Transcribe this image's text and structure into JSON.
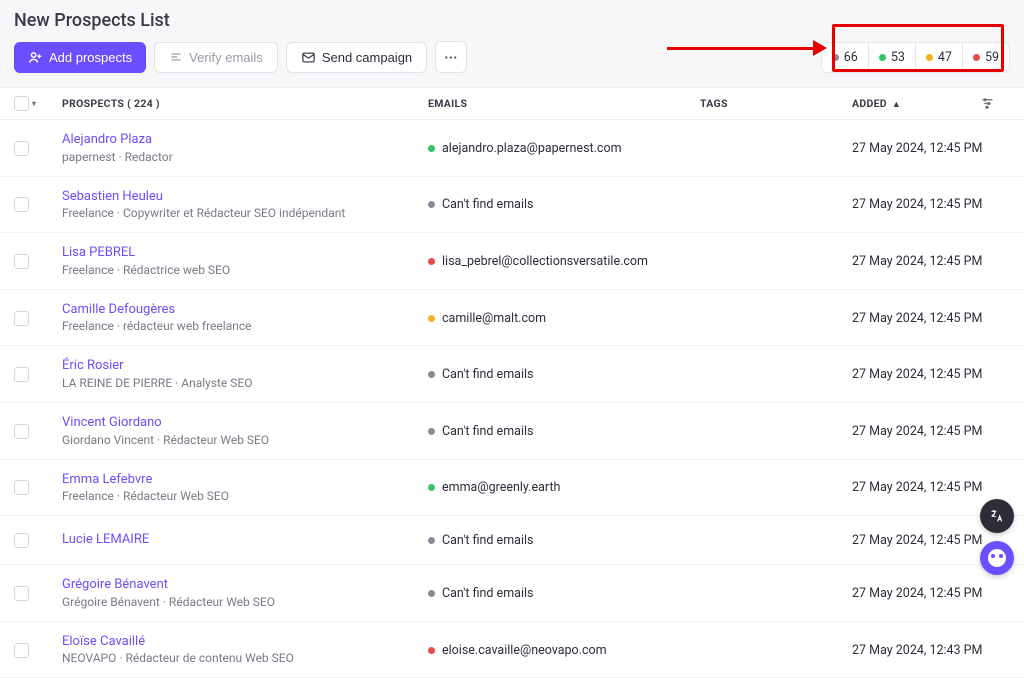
{
  "page_title": "New Prospects List",
  "toolbar": {
    "add_prospects": "Add prospects",
    "verify_emails": "Verify emails",
    "send_campaign": "Send campaign",
    "more_label": "···"
  },
  "status_counts": {
    "gray": "66",
    "green": "53",
    "yellow": "47",
    "red": "59"
  },
  "columns": {
    "prospects": "PROSPECTS",
    "prospects_count": "( 224 )",
    "emails": "EMAILS",
    "tags": "TAGS",
    "added": "ADDED"
  },
  "rows": [
    {
      "name": "Alejandro Plaza",
      "subtitle": "papernest  ·  Redactor",
      "dot": "green",
      "email": "alejandro.plaza@papernest.com",
      "added": "27 May 2024, 12:45 PM"
    },
    {
      "name": "Sebastien Heuleu",
      "subtitle": "Freelance  ·  Copywriter et Rédacteur SEO indépendant",
      "dot": "gray",
      "email": "Can't find emails",
      "added": "27 May 2024, 12:45 PM"
    },
    {
      "name": "Lisa PEBREL",
      "subtitle": "Freelance  ·  Rédactrice web SEO",
      "dot": "red",
      "email": "lisa_pebrel@collectionsversatile.com",
      "added": "27 May 2024, 12:45 PM"
    },
    {
      "name": "Camille Defougères",
      "subtitle": "Freelance  ·  rédacteur web freelance",
      "dot": "yellow",
      "email": "camille@malt.com",
      "added": "27 May 2024, 12:45 PM"
    },
    {
      "name": "Éric Rosier",
      "subtitle": "LA REINE DE PIERRE  ·  Analyste SEO",
      "dot": "gray",
      "email": "Can't find emails",
      "added": "27 May 2024, 12:45 PM"
    },
    {
      "name": "Vincent Giordano",
      "subtitle": "Giordano Vincent  ·  Rédacteur Web SEO",
      "dot": "gray",
      "email": "Can't find emails",
      "added": "27 May 2024, 12:45 PM"
    },
    {
      "name": "Emma Lefebvre",
      "subtitle": "Freelance  ·  Rédacteur Web SEO",
      "dot": "green",
      "email": "emma@greenly.earth",
      "added": "27 May 2024, 12:45 PM"
    },
    {
      "name": "Lucie LEMAIRE",
      "subtitle": "",
      "dot": "gray",
      "email": "Can't find emails",
      "added": "27 May 2024, 12:45 PM"
    },
    {
      "name": "Grégoire Bénavent",
      "subtitle": "Grégoire Bénavent  ·  Rédacteur Web SEO",
      "dot": "gray",
      "email": "Can't find emails",
      "added": "27 May 2024, 12:45 PM"
    },
    {
      "name": "Eloïse Cavaillé",
      "subtitle": "NEOVAPO  ·  Rédacteur de contenu Web SEO",
      "dot": "red",
      "email": "eloise.cavaille@neovapo.com",
      "added": "27 May 2024, 12:43 PM"
    }
  ]
}
